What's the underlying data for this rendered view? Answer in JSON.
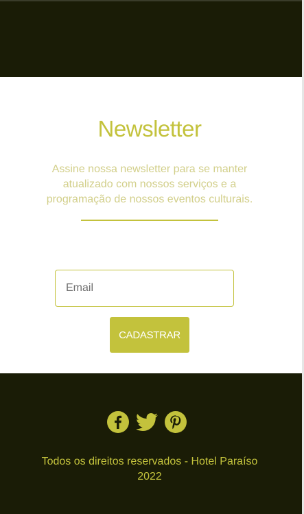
{
  "newsletter": {
    "title": "Newsletter",
    "description": "Assine nossa newsletter para se manter atualizado com nossos serviços e a programação de nossos eventos culturais.",
    "email_placeholder": "Email",
    "submit_label": "CADASTRAR"
  },
  "footer": {
    "social_icons": [
      "facebook-icon",
      "twitter-icon",
      "pinterest-icon"
    ],
    "copyright_line1": "Todos os direitos reservados - Hotel Paraíso",
    "copyright_line2": "2022"
  },
  "colors": {
    "dark_background": "#1a1c06",
    "accent": "#c3c23c",
    "description_text": "#d2cf8a",
    "button_text": "#ffffff"
  }
}
